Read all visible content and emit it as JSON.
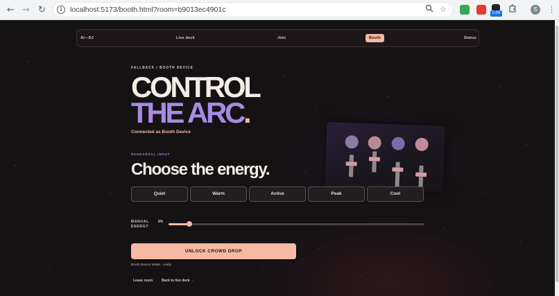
{
  "browser": {
    "url": "localhost:5173/booth.html?room=b9013ec4901c",
    "extension_badge": "0.09",
    "profile_initial": "S"
  },
  "nav": {
    "brand": "AI—DJ",
    "items": [
      "Live deck",
      "Join",
      "Booth",
      "Status"
    ],
    "active": "Booth"
  },
  "hero": {
    "eyebrow": "FALLBACK / BOOTH DEVICE",
    "line1": "CONTROL",
    "line2": "THE ARC",
    "line2_dot": ".",
    "connected": "Connected as Booth Device"
  },
  "energy": {
    "section_label": "REHEARSAL INPUT",
    "heading": "Choose the energy.",
    "options": [
      "Quiet",
      "Warm",
      "Active",
      "Peak",
      "Cool"
    ]
  },
  "manual": {
    "label": "MANUAL ENERGY",
    "value_text": "8%",
    "value": 0.08
  },
  "actions": {
    "cta": "UNLOCK CROWD DROP",
    "status": "Booth Device Mode · ready",
    "leave": "Leave room",
    "back": "Back to live deck →"
  },
  "colors": {
    "accent_peach": "#f6b9a4",
    "accent_purple": "#a98ae3",
    "background": "#151214",
    "text": "#f4ede6"
  },
  "icons": {
    "back": "arrow-left-icon",
    "forward": "arrow-right-icon",
    "reload": "reload-icon",
    "site_info": "info-icon",
    "zoom": "magnifier-icon",
    "bookmark": "star-icon",
    "extensions": "puzzle-icon",
    "menu": "kebab-icon"
  }
}
